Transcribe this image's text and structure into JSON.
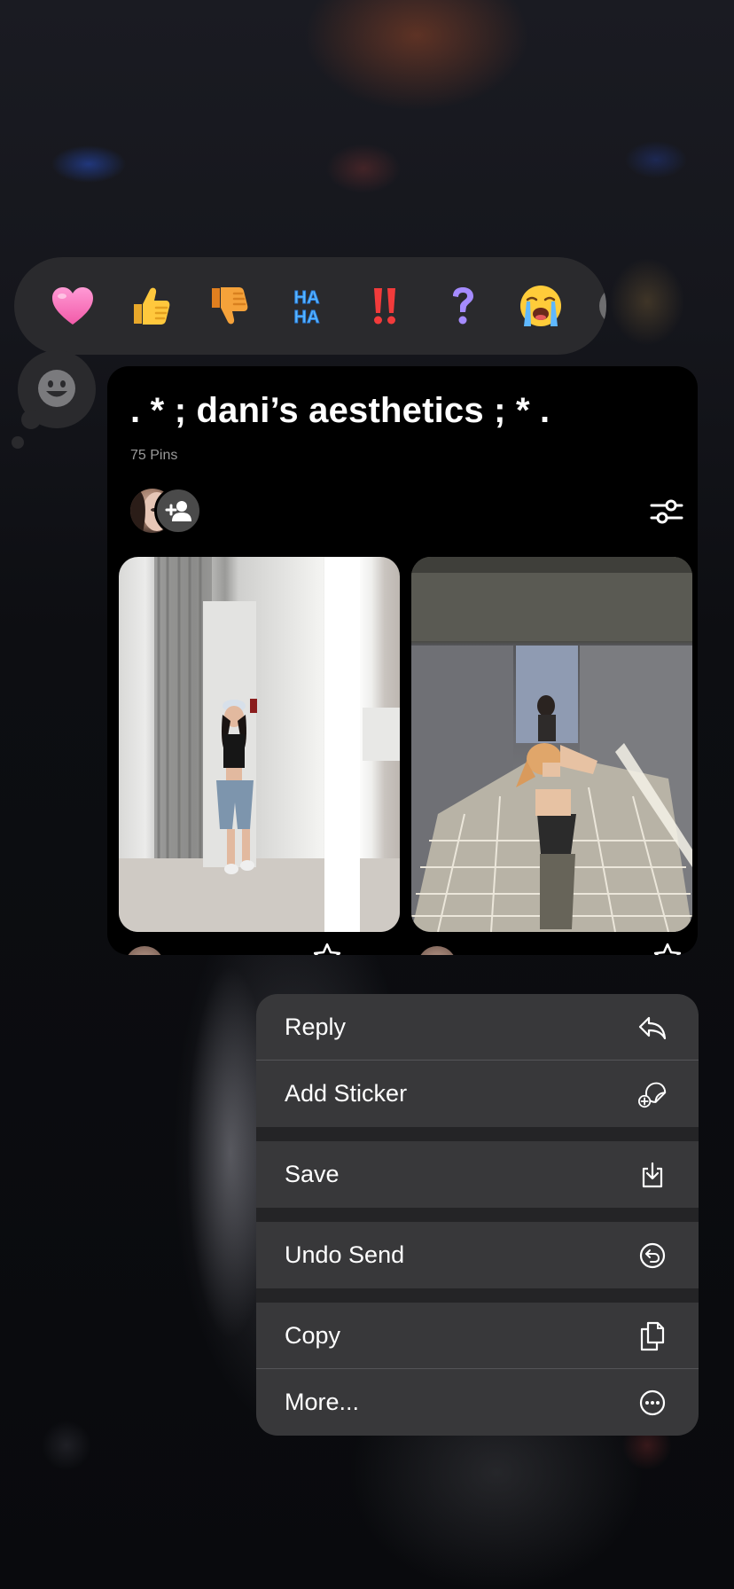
{
  "reactions": [
    {
      "name": "heart",
      "label": "❤"
    },
    {
      "name": "thumbs-up",
      "label": "👍"
    },
    {
      "name": "thumbs-down",
      "label": "👎"
    },
    {
      "name": "haha",
      "label": "HA HA"
    },
    {
      "name": "exclamation",
      "label": "‼"
    },
    {
      "name": "question",
      "label": "?"
    },
    {
      "name": "crying",
      "label": "😭"
    }
  ],
  "card": {
    "title": ". * ; dani’s aesthetics ; * .",
    "pin_count": "75 Pins"
  },
  "menu": {
    "reply": "Reply",
    "add_sticker": "Add Sticker",
    "save": "Save",
    "undo_send": "Undo Send",
    "copy": "Copy",
    "more": "More..."
  },
  "icons": {
    "reply": "reply-arrow-icon",
    "add_sticker": "sticker-add-icon",
    "save": "save-download-icon",
    "undo_send": "undo-icon",
    "copy": "copy-icon",
    "more": "more-ellipsis-icon"
  },
  "colors": {
    "menu_bg": "#38383a",
    "reaction_bar_bg": "#2a2a2d",
    "card_bg": "#000000"
  }
}
